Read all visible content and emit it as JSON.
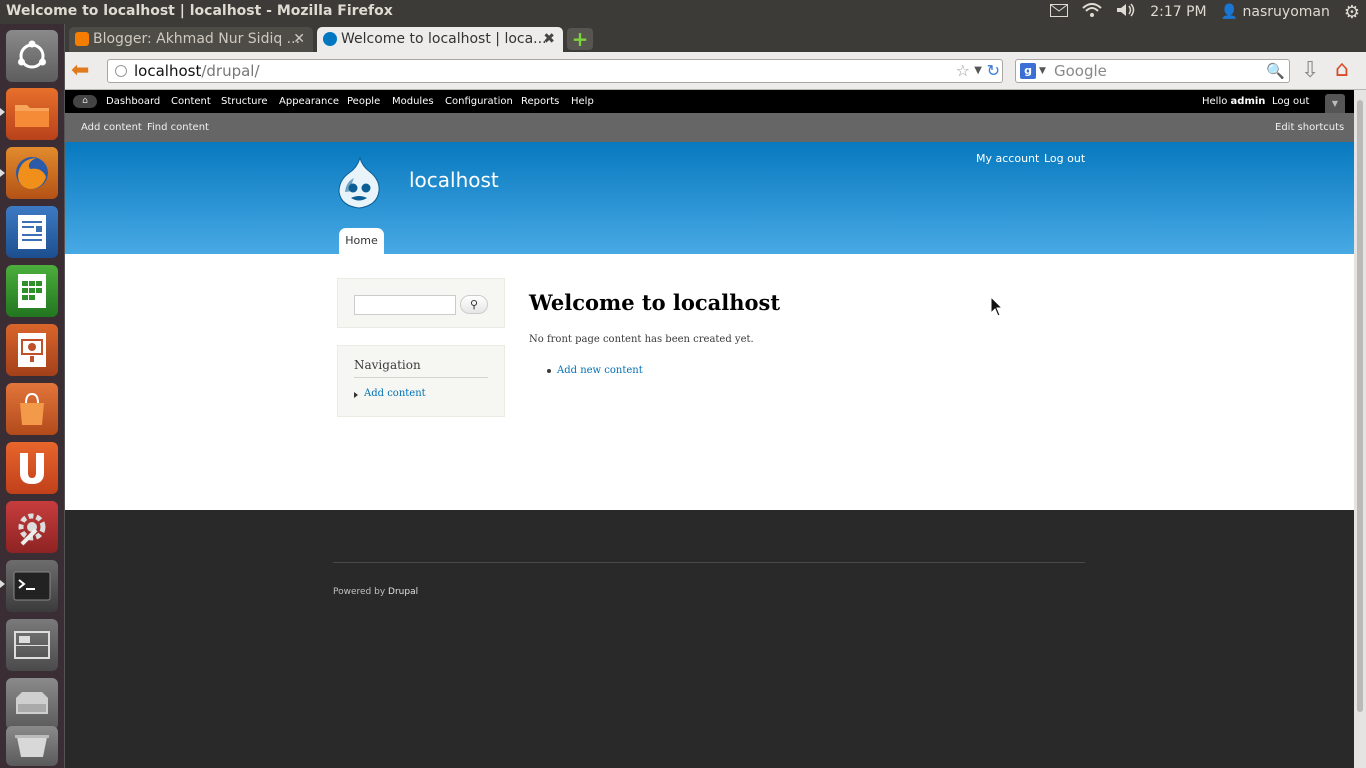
{
  "window": {
    "title": "Welcome to localhost | localhost - Mozilla Firefox",
    "clock": "2:17 PM",
    "user": "nasruyoman"
  },
  "tabs": [
    {
      "label": "Blogger: Akhmad Nur Sidiq ...",
      "close": "✕",
      "favicon_color": "#f57d00"
    },
    {
      "label": "Welcome to localhost | loca...",
      "close": "✖",
      "favicon_color": "#0077c0"
    }
  ],
  "navbar": {
    "url_host": "localhost",
    "url_path": "/drupal/",
    "search_placeholder": "Google",
    "search_engine_letter": "g"
  },
  "toolbar": {
    "home_icon": "⌂",
    "menu": [
      "Dashboard",
      "Content",
      "Structure",
      "Appearance",
      "People",
      "Modules",
      "Configuration",
      "Reports",
      "Help"
    ],
    "hello": "Hello ",
    "username": "admin",
    "logout": "Log out",
    "toggle": "▼"
  },
  "shortcuts": {
    "items": [
      "Add content",
      "Find content"
    ],
    "edit": "Edit shortcuts"
  },
  "header": {
    "site_name": "localhost",
    "my_account": "My account",
    "log_out": "Log out",
    "home_tab": "Home"
  },
  "sidebar": {
    "search_button": "⚲",
    "nav_title": "Navigation",
    "nav_item": "Add content"
  },
  "content": {
    "title": "Welcome to localhost",
    "message": "No front page content has been created yet.",
    "add_link": "Add new content"
  },
  "footer": {
    "powered_by": "Powered by ",
    "drupal": "Drupal"
  },
  "colors": {
    "header_top": "#0779bf",
    "header_bottom": "#48a9e4",
    "link": "#0071b3",
    "footer": "#292929"
  }
}
